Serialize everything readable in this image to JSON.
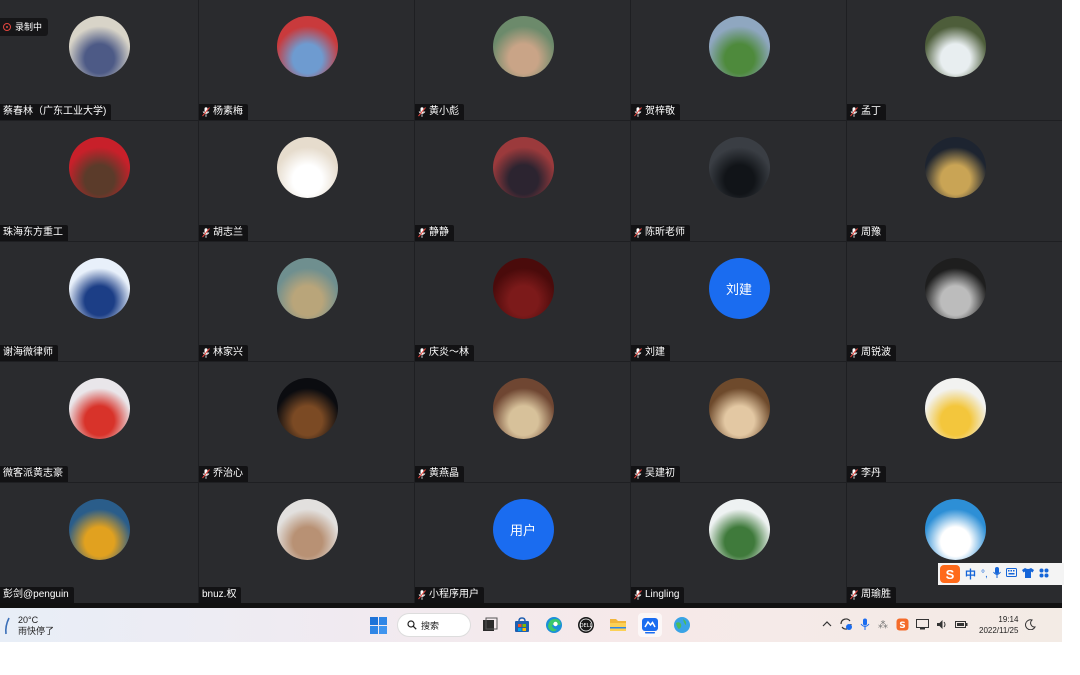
{
  "recording": {
    "label": "录制中"
  },
  "participants": [
    {
      "name": "蔡春林（广东工业大学)",
      "mic": false,
      "avatar": {
        "type": "photo",
        "bg": "#d8d4c8",
        "fg": "#4d5a86"
      }
    },
    {
      "name": "杨素梅",
      "mic": true,
      "avatar": {
        "type": "photo",
        "bg": "#c93a3c",
        "fg": "#6e9bd0"
      }
    },
    {
      "name": "黄小彪",
      "mic": true,
      "avatar": {
        "type": "photo",
        "bg": "#6c8a6b",
        "fg": "#c9a487"
      }
    },
    {
      "name": "贺梓敬",
      "mic": true,
      "avatar": {
        "type": "photo",
        "bg": "#8fa7c0",
        "fg": "#4e8a3c"
      }
    },
    {
      "name": "孟丁",
      "mic": true,
      "avatar": {
        "type": "photo",
        "bg": "#4d5d3a",
        "fg": "#e8eef0"
      }
    },
    {
      "name": "珠海东方重工",
      "mic": false,
      "avatar": {
        "type": "photo",
        "bg": "#c8202a",
        "fg": "#5b3b2a"
      }
    },
    {
      "name": "胡志兰",
      "mic": true,
      "avatar": {
        "type": "photo",
        "bg": "#e6dccd",
        "fg": "#ffffff"
      }
    },
    {
      "name": "静静",
      "mic": true,
      "avatar": {
        "type": "photo",
        "bg": "#9b3a3c",
        "fg": "#2c2430"
      }
    },
    {
      "name": "陈昕老师",
      "mic": true,
      "avatar": {
        "type": "photo",
        "bg": "#3a3e44",
        "fg": "#111418"
      }
    },
    {
      "name": "周豫",
      "mic": true,
      "avatar": {
        "type": "photo",
        "bg": "#1d2430",
        "fg": "#c9a455"
      }
    },
    {
      "name": "谢海微律师",
      "mic": false,
      "avatar": {
        "type": "photo",
        "bg": "#e8f0fa",
        "fg": "#1c3e86"
      }
    },
    {
      "name": "林家兴",
      "mic": true,
      "avatar": {
        "type": "photo",
        "bg": "#6f8f8f",
        "fg": "#b9a57a"
      }
    },
    {
      "name": "庆炎～林",
      "mic": true,
      "avatar": {
        "type": "photo",
        "bg": "#4a0b0b",
        "fg": "#7c1a1a"
      }
    },
    {
      "name": "刘建",
      "mic": true,
      "avatar": {
        "type": "text",
        "text": "刘建"
      }
    },
    {
      "name": "周锐波",
      "mic": true,
      "avatar": {
        "type": "photo",
        "bg": "#1e1e1e",
        "fg": "#bcbcbc"
      }
    },
    {
      "name": "微客派黄志豪",
      "mic": false,
      "avatar": {
        "type": "photo",
        "bg": "#e9e6ea",
        "fg": "#d8332a"
      }
    },
    {
      "name": "乔治心",
      "mic": true,
      "avatar": {
        "type": "photo",
        "bg": "#0b0c10",
        "fg": "#7b4a24"
      }
    },
    {
      "name": "黄燕晶",
      "mic": true,
      "avatar": {
        "type": "photo",
        "bg": "#6f4632",
        "fg": "#d7c19a"
      }
    },
    {
      "name": "吴建初",
      "mic": true,
      "avatar": {
        "type": "photo",
        "bg": "#6e4a2c",
        "fg": "#e3c8a3"
      }
    },
    {
      "name": "李丹",
      "mic": true,
      "avatar": {
        "type": "photo",
        "bg": "#f2f2f0",
        "fg": "#f3c63c"
      }
    },
    {
      "name": "彭剑@penguin",
      "mic": false,
      "avatar": {
        "type": "photo",
        "bg": "#2a5d8a",
        "fg": "#e1a11f"
      }
    },
    {
      "name": "bnuz.权",
      "mic": false,
      "avatar": {
        "type": "photo",
        "bg": "#e2e0de",
        "fg": "#b89174"
      }
    },
    {
      "name": "小程序用户",
      "mic": true,
      "avatar": {
        "type": "text",
        "text": "用户"
      }
    },
    {
      "name": "Lingling",
      "mic": true,
      "avatar": {
        "type": "photo",
        "bg": "#eef2f2",
        "fg": "#3f7a3b"
      }
    },
    {
      "name": "周瑜胜",
      "mic": true,
      "avatar": {
        "type": "photo",
        "bg": "#2d8fd6",
        "fg": "#ffffff"
      }
    }
  ],
  "ime": {
    "zh": "中",
    "punct": "°,",
    "mic": "🎤",
    "kbd": "⌨",
    "skin": "👕",
    "apps": "▦"
  },
  "taskbar": {
    "weather": {
      "temp": "20°C",
      "desc": "雨快停了"
    },
    "search_label": "搜索",
    "apps": [
      "task-view",
      "store",
      "edge",
      "dell",
      "file-explorer",
      "meeting",
      "browser"
    ],
    "clock": {
      "time": "19:14",
      "date": "2022/11/25"
    }
  },
  "colors": {
    "tile_bg": "#2a2b2e",
    "avatar_blue": "#1a6cf0",
    "sogou": "#ff6a1a",
    "rec_red": "#e2463f"
  }
}
